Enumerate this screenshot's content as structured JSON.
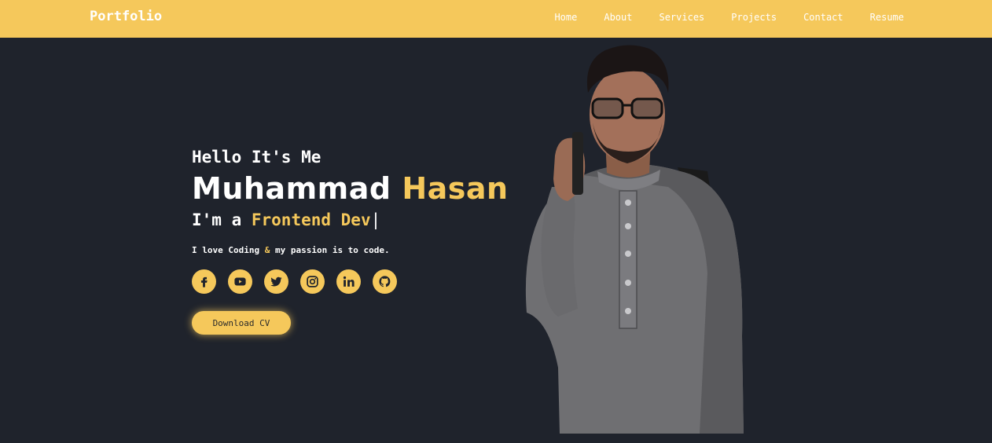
{
  "nav": {
    "brand": "Portfolio",
    "links": [
      "Home",
      "About",
      "Services",
      "Projects",
      "Contact",
      "Resume"
    ]
  },
  "hero": {
    "greeting": "Hello It's Me",
    "first_name": "Muhammad",
    "last_name": "Hasan",
    "role_prefix": "I'm a",
    "role_highlight": "Frontend Dev",
    "role_cursor": "|",
    "tagline_part1": "I love Coding",
    "tagline_amp": "&",
    "tagline_part2": "my passion is to code.",
    "cv_button": "Download CV"
  },
  "socials": [
    "facebook-icon",
    "youtube-icon",
    "twitter-icon",
    "instagram-icon",
    "linkedin-icon",
    "github-icon"
  ],
  "colors": {
    "accent": "#f5c85b",
    "background": "#1f232c",
    "text": "#ffffff"
  }
}
